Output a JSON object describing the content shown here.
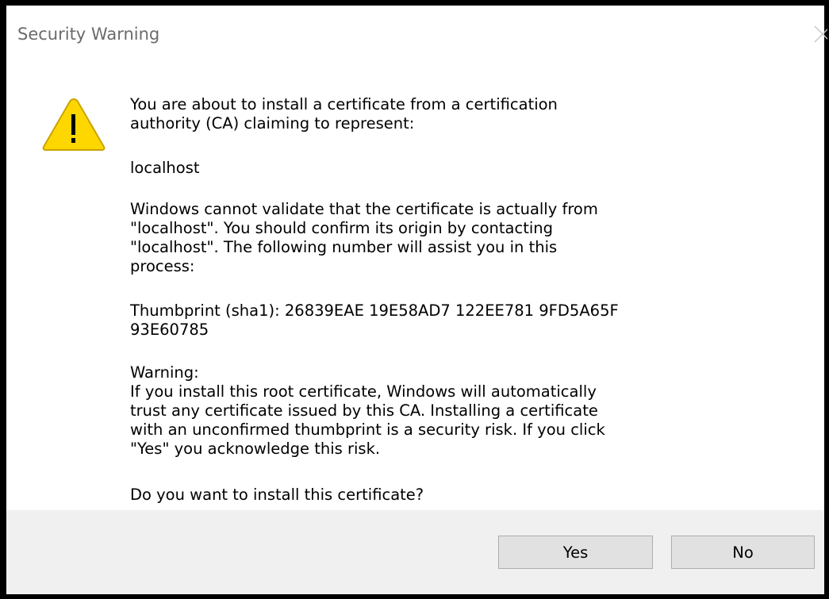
{
  "window": {
    "title": "Security Warning",
    "close_icon": "close-icon"
  },
  "icon": {
    "name": "warning-icon",
    "color": "#ffd700",
    "glyph": "!"
  },
  "message": {
    "intro": "You are about to install a certificate from a certification\nauthority (CA) claiming to represent:",
    "host": "localhost",
    "validation": "Windows cannot validate that the certificate is actually from\n\"localhost\". You should confirm its origin by contacting\n\"localhost\". The following number will assist you in this\nprocess:",
    "thumbprint": "Thumbprint (sha1): 26839EAE 19E58AD7 122EE781 9FD5A65F\n93E60785",
    "warning": "Warning:\nIf you install this root certificate, Windows will automatically\ntrust any certificate issued by this CA. Installing a certificate\nwith an unconfirmed thumbprint is a security risk. If you click\n\"Yes\" you acknowledge this risk.",
    "question": "Do you want to install this certificate?"
  },
  "buttons": {
    "yes_label": "Yes",
    "no_label": "No"
  },
  "colors": {
    "footer_bg": "#f0f0f0",
    "button_bg": "#e1e1e1",
    "title_text": "#6b6b6b"
  }
}
